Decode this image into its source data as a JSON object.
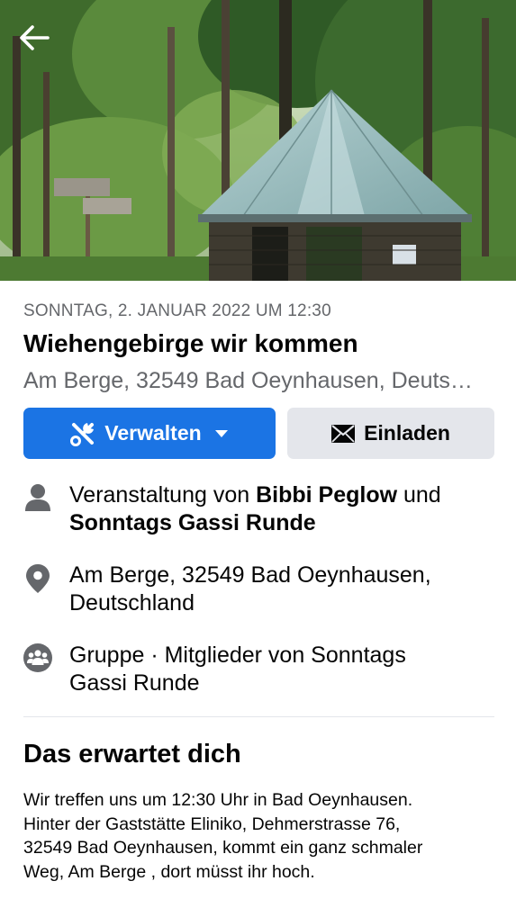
{
  "event": {
    "date": "SONNTAG, 2. JANUAR 2022 UM 12:30",
    "title": "Wiehengebirge wir kommen",
    "location_short": "Am Berge, 32549 Bad Oeynhausen, Deuts…"
  },
  "actions": {
    "manage_label": "Verwalten",
    "invite_label": "Einladen"
  },
  "details": {
    "host_prefix": "Veranstaltung von ",
    "host_name": "Bibbi Peglow",
    "host_joiner": " und",
    "host_group": "Sonntags Gassi Runde",
    "address": "Am Berge, 32549 Bad Oeynhausen, Deutschland",
    "privacy": "Gruppe · Mitglieder von Sonntags Gassi Runde"
  },
  "about": {
    "heading": "Das erwartet dich",
    "text": "Wir treffen uns um 12:30 Uhr in Bad Oeynhausen.\nHinter der Gaststätte Eliniko, Dehmerstrasse 76,\n32549 Bad Oeynhausen,  kommt ein ganz schmaler\nWeg, Am Berge , dort müsst ihr hoch."
  },
  "icons": {
    "back": "arrow-left-icon",
    "manage": "tools-icon",
    "dropdown": "caret-down-icon",
    "invite": "envelope-icon",
    "host": "person-icon",
    "location": "map-pin-icon",
    "privacy": "group-icon"
  },
  "colors": {
    "primary": "#1b74e4",
    "secondary_button": "#e4e6eb",
    "muted_text": "#65676b",
    "icon_gray": "#65676b"
  }
}
